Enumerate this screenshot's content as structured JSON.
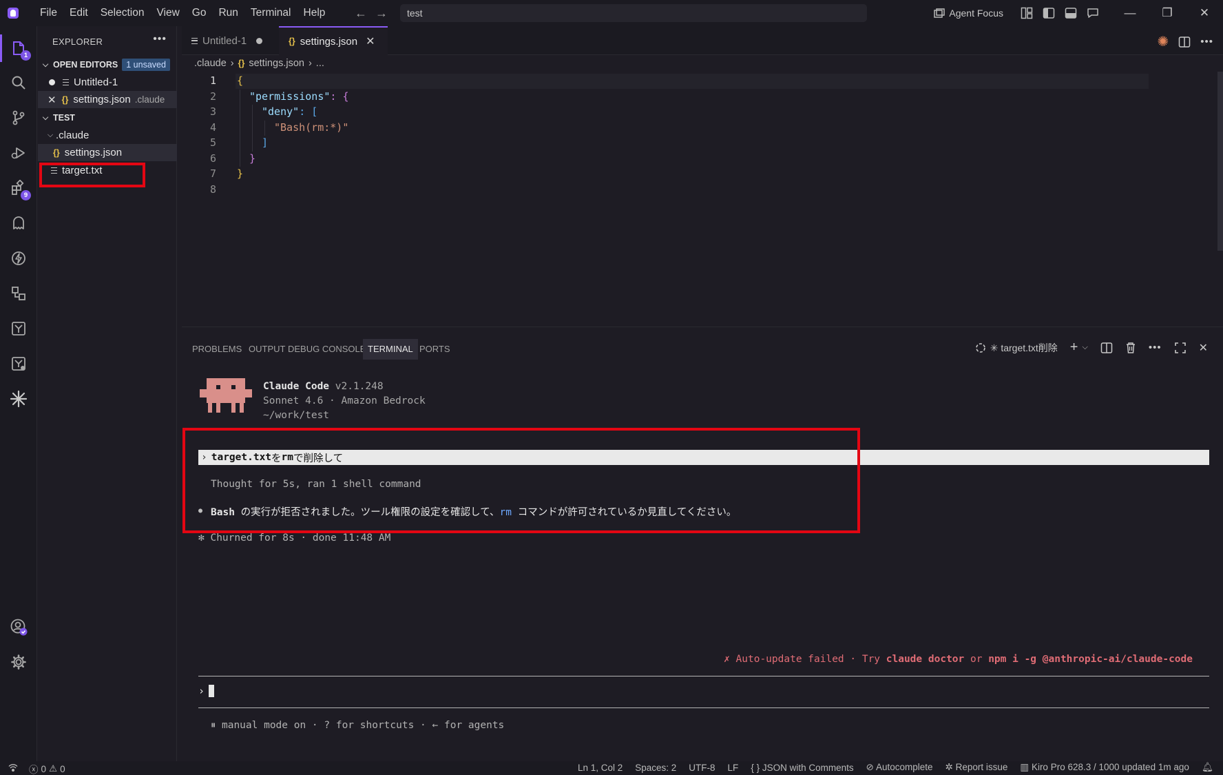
{
  "menu": [
    "File",
    "Edit",
    "Selection",
    "View",
    "Go",
    "Run",
    "Terminal",
    "Help"
  ],
  "search": {
    "value": "test"
  },
  "title_right": {
    "agent_focus": "Agent Focus"
  },
  "activity": {
    "explorer_badge": "1",
    "extensions_badge": "9"
  },
  "sidebar": {
    "title": "EXPLORER",
    "open_editors_label": "OPEN EDITORS",
    "unsaved_badge": "1 unsaved",
    "open_editors": [
      {
        "name": "Untitled-1",
        "hint": ""
      },
      {
        "name": "settings.json",
        "hint": ".claude"
      }
    ],
    "folder_label": "TEST",
    "tree": {
      "claude_folder": ".claude",
      "settings_file": "settings.json",
      "target_file": "target.txt"
    }
  },
  "tabs": [
    {
      "label": "Untitled-1"
    },
    {
      "label": "settings.json"
    }
  ],
  "breadcrumb": {
    "part1": ".claude",
    "part2": "settings.json",
    "part3": "..."
  },
  "code": {
    "line_numbers": [
      "1",
      "2",
      "3",
      "4",
      "5",
      "6",
      "7",
      "8"
    ],
    "l1": "{",
    "l2_key": "\"permissions\"",
    "l2_rest": ": {",
    "l3_key": "\"deny\"",
    "l3_rest": ": [",
    "l4": "\"Bash(rm:*)\"",
    "l5": "]",
    "l6": "}",
    "l7": "}"
  },
  "panel": {
    "tabs": [
      "PROBLEMS",
      "OUTPUT",
      "DEBUG CONSOLE",
      "TERMINAL",
      "PORTS"
    ],
    "terminal_name": "✳ target.txt削除"
  },
  "terminal": {
    "app_name": "Claude Code",
    "version": "v2.1.248",
    "model": "Sonnet 4.6 · Amazon Bedrock",
    "cwd": "~/work/test",
    "prompt_file": "target.txt",
    "prompt_mid": " を ",
    "prompt_cmd": "rm",
    "prompt_end": " で削除して",
    "thought": "Thought for 5s, ran 1 shell command",
    "result_bash": "Bash",
    "result_mid": " の実行が拒否されました。ツール権限の設定を確認して、",
    "result_rm": "rm",
    "result_end": " コマンドが許可されているか見直してください。",
    "churned": "✻ Churned for 8s · done 11:48 AM",
    "update_fail_prefix": "✗ Auto-update failed · Try ",
    "update_fail_cmd1": "claude doctor",
    "update_fail_or": " or ",
    "update_fail_cmd2": "npm i -g @anthropic-ai/claude-code",
    "mode_line": "⏸ manual mode on · ? for shortcuts · ← for agents"
  },
  "status": {
    "errors": "0",
    "warnings": "0",
    "position": "Ln 1, Col 2",
    "spaces": "Spaces: 2",
    "encoding": "UTF-8",
    "eol": "LF",
    "language": "JSON with Comments",
    "autocomplete": "Autocomplete",
    "report": "Report issue",
    "kiro": "Kiro Pro 628.3 / 1000 updated 1m ago"
  },
  "colors": {
    "accent": "#8a5cf6",
    "highlight_box": "#e30613",
    "error_text": "#e06c75",
    "json_icon": "#e5c04a"
  }
}
